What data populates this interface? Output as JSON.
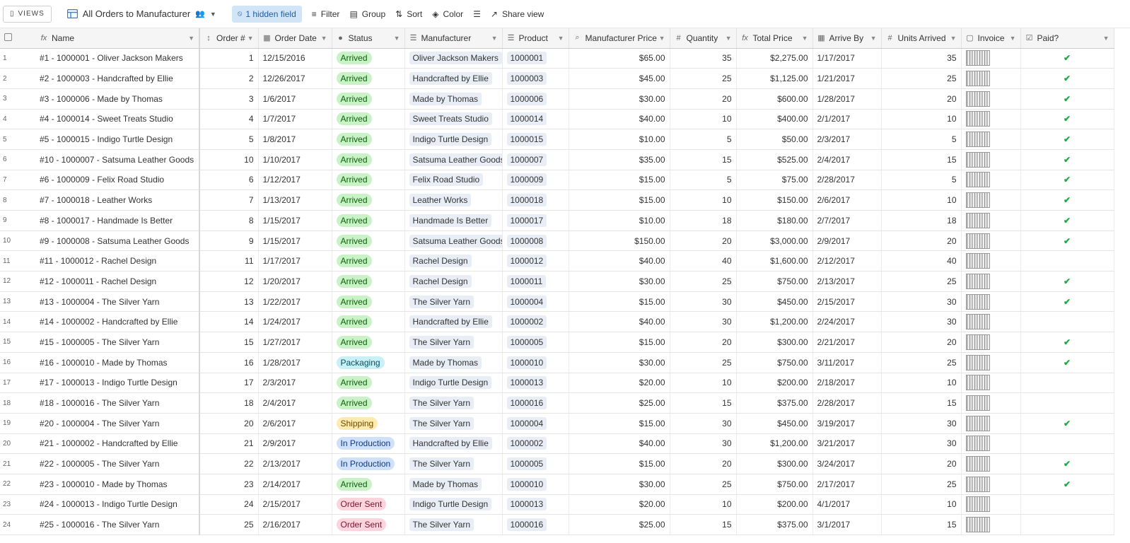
{
  "toolbar": {
    "views_label": "VIEWS",
    "view_title": "All Orders to Manufacturer",
    "hidden_fields": "1 hidden field",
    "filter": "Filter",
    "group": "Group",
    "sort": "Sort",
    "color": "Color",
    "share": "Share view"
  },
  "columns": [
    "Name",
    "Order #",
    "Order Date",
    "Status",
    "Manufacturer",
    "Product",
    "Manufacturer Price",
    "Quantity",
    "Total Price",
    "Arrive By",
    "Units Arrived",
    "Invoice",
    "Paid?"
  ],
  "colors": {
    "accent": "#2d7ff9",
    "paid_check": "#20a846"
  },
  "status_colors": {
    "Arrived": {
      "bg": "#c9f2c7",
      "fg": "#0b5d0b"
    },
    "Packaging": {
      "bg": "#c8f0f6",
      "fg": "#0a4f5c"
    },
    "Shipping": {
      "bg": "#ffeab0",
      "fg": "#6a4a00"
    },
    "In Production": {
      "bg": "#cfe0fb",
      "fg": "#123a7a"
    },
    "Order Sent": {
      "bg": "#fcd4dd",
      "fg": "#7a1530"
    }
  },
  "rows": [
    {
      "n": "1",
      "name": "#1 - 1000001 - Oliver Jackson Makers",
      "order": "1",
      "date": "12/15/2016",
      "status": "Arrived",
      "mfr": "Oliver Jackson Makers",
      "product": "1000001",
      "price": "$65.00",
      "qty": "35",
      "total": "$2,275.00",
      "arrive": "1/17/2017",
      "units": "35",
      "paid": "✔"
    },
    {
      "n": "2",
      "name": "#2 - 1000003 - Handcrafted by Ellie",
      "order": "2",
      "date": "12/26/2017",
      "status": "Arrived",
      "mfr": "Handcrafted by Ellie",
      "product": "1000003",
      "price": "$45.00",
      "qty": "25",
      "total": "$1,125.00",
      "arrive": "1/21/2017",
      "units": "25",
      "paid": "✔"
    },
    {
      "n": "3",
      "name": "#3 - 1000006 - Made by Thomas",
      "order": "3",
      "date": "1/6/2017",
      "status": "Arrived",
      "mfr": "Made by Thomas",
      "product": "1000006",
      "price": "$30.00",
      "qty": "20",
      "total": "$600.00",
      "arrive": "1/28/2017",
      "units": "20",
      "paid": "✔"
    },
    {
      "n": "4",
      "name": "#4 - 1000014 - Sweet Treats Studio",
      "order": "4",
      "date": "1/7/2017",
      "status": "Arrived",
      "mfr": "Sweet Treats Studio",
      "product": "1000014",
      "price": "$40.00",
      "qty": "10",
      "total": "$400.00",
      "arrive": "2/1/2017",
      "units": "10",
      "paid": "✔"
    },
    {
      "n": "5",
      "name": "#5 - 1000015 - Indigo Turtle Design",
      "order": "5",
      "date": "1/8/2017",
      "status": "Arrived",
      "mfr": "Indigo Turtle Design",
      "product": "1000015",
      "price": "$10.00",
      "qty": "5",
      "total": "$50.00",
      "arrive": "2/3/2017",
      "units": "5",
      "paid": "✔"
    },
    {
      "n": "6",
      "name": "#10 - 1000007 - Satsuma Leather Goods",
      "order": "10",
      "date": "1/10/2017",
      "status": "Arrived",
      "mfr": "Satsuma Leather Goods",
      "product": "1000007",
      "price": "$35.00",
      "qty": "15",
      "total": "$525.00",
      "arrive": "2/4/2017",
      "units": "15",
      "paid": "✔"
    },
    {
      "n": "7",
      "name": "#6 - 1000009 - Felix Road Studio",
      "order": "6",
      "date": "1/12/2017",
      "status": "Arrived",
      "mfr": "Felix Road Studio",
      "product": "1000009",
      "price": "$15.00",
      "qty": "5",
      "total": "$75.00",
      "arrive": "2/28/2017",
      "units": "5",
      "paid": "✔"
    },
    {
      "n": "8",
      "name": "#7 - 1000018 - Leather Works",
      "order": "7",
      "date": "1/13/2017",
      "status": "Arrived",
      "mfr": "Leather Works",
      "product": "1000018",
      "price": "$15.00",
      "qty": "10",
      "total": "$150.00",
      "arrive": "2/6/2017",
      "units": "10",
      "paid": "✔"
    },
    {
      "n": "9",
      "name": "#8 - 1000017 - Handmade Is Better",
      "order": "8",
      "date": "1/15/2017",
      "status": "Arrived",
      "mfr": "Handmade Is Better",
      "product": "1000017",
      "price": "$10.00",
      "qty": "18",
      "total": "$180.00",
      "arrive": "2/7/2017",
      "units": "18",
      "paid": "✔"
    },
    {
      "n": "10",
      "name": "#9 - 1000008 - Satsuma Leather Goods",
      "order": "9",
      "date": "1/15/2017",
      "status": "Arrived",
      "mfr": "Satsuma Leather Goods",
      "product": "1000008",
      "price": "$150.00",
      "qty": "20",
      "total": "$3,000.00",
      "arrive": "2/9/2017",
      "units": "20",
      "paid": "✔"
    },
    {
      "n": "11",
      "name": "#11 - 1000012 - Rachel Design",
      "order": "11",
      "date": "1/17/2017",
      "status": "Arrived",
      "mfr": "Rachel Design",
      "product": "1000012",
      "price": "$40.00",
      "qty": "40",
      "total": "$1,600.00",
      "arrive": "2/12/2017",
      "units": "40",
      "paid": ""
    },
    {
      "n": "12",
      "name": "#12 - 1000011 - Rachel Design",
      "order": "12",
      "date": "1/20/2017",
      "status": "Arrived",
      "mfr": "Rachel Design",
      "product": "1000011",
      "price": "$30.00",
      "qty": "25",
      "total": "$750.00",
      "arrive": "2/13/2017",
      "units": "25",
      "paid": "✔"
    },
    {
      "n": "13",
      "name": "#13 - 1000004 - The Silver Yarn",
      "order": "13",
      "date": "1/22/2017",
      "status": "Arrived",
      "mfr": "The Silver Yarn",
      "product": "1000004",
      "price": "$15.00",
      "qty": "30",
      "total": "$450.00",
      "arrive": "2/15/2017",
      "units": "30",
      "paid": "✔"
    },
    {
      "n": "14",
      "name": "#14 - 1000002 - Handcrafted by Ellie",
      "order": "14",
      "date": "1/24/2017",
      "status": "Arrived",
      "mfr": "Handcrafted by Ellie",
      "product": "1000002",
      "price": "$40.00",
      "qty": "30",
      "total": "$1,200.00",
      "arrive": "2/24/2017",
      "units": "30",
      "paid": ""
    },
    {
      "n": "15",
      "name": "#15 - 1000005 - The Silver Yarn",
      "order": "15",
      "date": "1/27/2017",
      "status": "Arrived",
      "mfr": "The Silver Yarn",
      "product": "1000005",
      "price": "$15.00",
      "qty": "20",
      "total": "$300.00",
      "arrive": "2/21/2017",
      "units": "20",
      "paid": "✔"
    },
    {
      "n": "16",
      "name": "#16 - 1000010 - Made by Thomas",
      "order": "16",
      "date": "1/28/2017",
      "status": "Packaging",
      "mfr": "Made by Thomas",
      "product": "1000010",
      "price": "$30.00",
      "qty": "25",
      "total": "$750.00",
      "arrive": "3/11/2017",
      "units": "25",
      "paid": "✔"
    },
    {
      "n": "17",
      "name": "#17 - 1000013 - Indigo Turtle Design",
      "order": "17",
      "date": "2/3/2017",
      "status": "Arrived",
      "mfr": "Indigo Turtle Design",
      "product": "1000013",
      "price": "$20.00",
      "qty": "10",
      "total": "$200.00",
      "arrive": "2/18/2017",
      "units": "10",
      "paid": ""
    },
    {
      "n": "18",
      "name": "#18 - 1000016 - The Silver Yarn",
      "order": "18",
      "date": "2/4/2017",
      "status": "Arrived",
      "mfr": "The Silver Yarn",
      "product": "1000016",
      "price": "$25.00",
      "qty": "15",
      "total": "$375.00",
      "arrive": "2/28/2017",
      "units": "15",
      "paid": ""
    },
    {
      "n": "19",
      "name": "#20 - 1000004 - The Silver Yarn",
      "order": "20",
      "date": "2/6/2017",
      "status": "Shipping",
      "mfr": "The Silver Yarn",
      "product": "1000004",
      "price": "$15.00",
      "qty": "30",
      "total": "$450.00",
      "arrive": "3/19/2017",
      "units": "30",
      "paid": "✔"
    },
    {
      "n": "20",
      "name": "#21 - 1000002 - Handcrafted by Ellie",
      "order": "21",
      "date": "2/9/2017",
      "status": "In Production",
      "mfr": "Handcrafted by Ellie",
      "product": "1000002",
      "price": "$40.00",
      "qty": "30",
      "total": "$1,200.00",
      "arrive": "3/21/2017",
      "units": "30",
      "paid": ""
    },
    {
      "n": "21",
      "name": "#22 - 1000005 - The Silver Yarn",
      "order": "22",
      "date": "2/13/2017",
      "status": "In Production",
      "mfr": "The Silver Yarn",
      "product": "1000005",
      "price": "$15.00",
      "qty": "20",
      "total": "$300.00",
      "arrive": "3/24/2017",
      "units": "20",
      "paid": "✔"
    },
    {
      "n": "22",
      "name": "#23 - 1000010 - Made by Thomas",
      "order": "23",
      "date": "2/14/2017",
      "status": "Arrived",
      "mfr": "Made by Thomas",
      "product": "1000010",
      "price": "$30.00",
      "qty": "25",
      "total": "$750.00",
      "arrive": "2/17/2017",
      "units": "25",
      "paid": "✔"
    },
    {
      "n": "23",
      "name": "#24 - 1000013 - Indigo Turtle Design",
      "order": "24",
      "date": "2/15/2017",
      "status": "Order Sent",
      "mfr": "Indigo Turtle Design",
      "product": "1000013",
      "price": "$20.00",
      "qty": "10",
      "total": "$200.00",
      "arrive": "4/1/2017",
      "units": "10",
      "paid": ""
    },
    {
      "n": "24",
      "name": "#25 - 1000016 - The Silver Yarn",
      "order": "25",
      "date": "2/16/2017",
      "status": "Order Sent",
      "mfr": "The Silver Yarn",
      "product": "1000016",
      "price": "$25.00",
      "qty": "15",
      "total": "$375.00",
      "arrive": "3/1/2017",
      "units": "15",
      "paid": ""
    }
  ]
}
